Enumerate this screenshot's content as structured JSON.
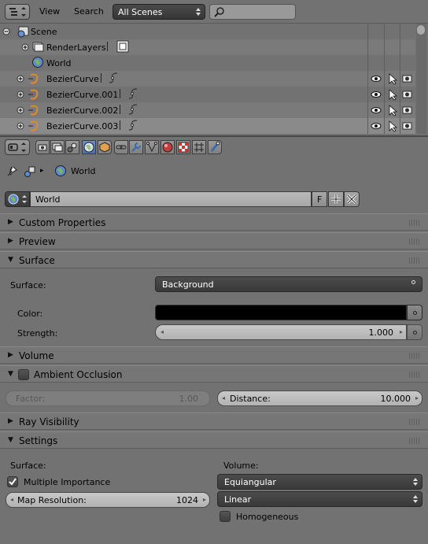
{
  "outliner": {
    "menu": {
      "view": "View",
      "search": "Search"
    },
    "scenes_select": "All Scenes",
    "search_placeholder": "",
    "items": [
      {
        "label": "Scene"
      },
      {
        "label": "RenderLayers"
      },
      {
        "label": "World"
      },
      {
        "label": "BezierCurve"
      },
      {
        "label": "BezierCurve.001"
      },
      {
        "label": "BezierCurve.002"
      },
      {
        "label": "BezierCurve.003"
      }
    ]
  },
  "properties": {
    "breadcrumb": {
      "item": "World"
    },
    "datablock": {
      "name": "World",
      "fake_user": "F"
    },
    "panels": {
      "custom_properties": "Custom Properties",
      "preview": "Preview",
      "surface": "Surface",
      "volume": "Volume",
      "ambient_occlusion": "Ambient Occlusion",
      "ray_visibility": "Ray Visibility",
      "settings": "Settings"
    },
    "surface": {
      "surface_label": "Surface:",
      "surface_value": "Background",
      "color_label": "Color:",
      "color_value": "#000000",
      "strength_label": "Strength:",
      "strength_value": "1.000"
    },
    "ao": {
      "factor_label": "Factor:",
      "factor_value": "1.00",
      "distance_label": "Distance:",
      "distance_value": "10.000"
    },
    "settings": {
      "surface_heading": "Surface:",
      "volume_heading": "Volume:",
      "multiple_importance": "Multiple Importance",
      "map_resolution_label": "Map Resolution:",
      "map_resolution_value": "1024",
      "volume_sampling": "Equiangular",
      "volume_interpolation": "Linear",
      "homogeneous": "Homogeneous"
    }
  },
  "colors": {
    "accent_blue": "#5680c2",
    "bg": "#727272",
    "field_dark": "#3e3e3e"
  }
}
